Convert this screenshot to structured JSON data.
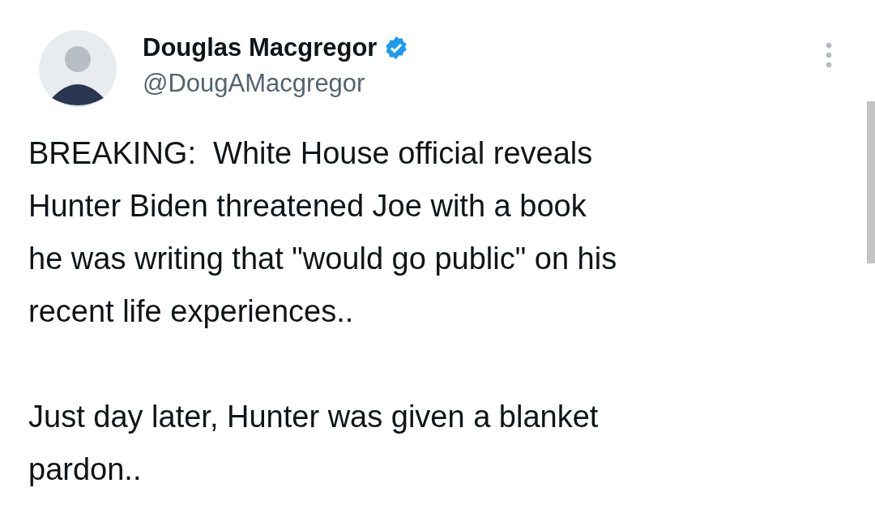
{
  "author": {
    "name": "Douglas Macgregor",
    "handle": "@DougAMacgregor",
    "verified": true
  },
  "paragraphs": [
    "BREAKING:  White House official reveals\nHunter Biden threatened Joe with a book\nhe was writing that \"would go public\" on his\nrecent life experiences..",
    "Just day later, Hunter was given a blanket\npardon.."
  ]
}
